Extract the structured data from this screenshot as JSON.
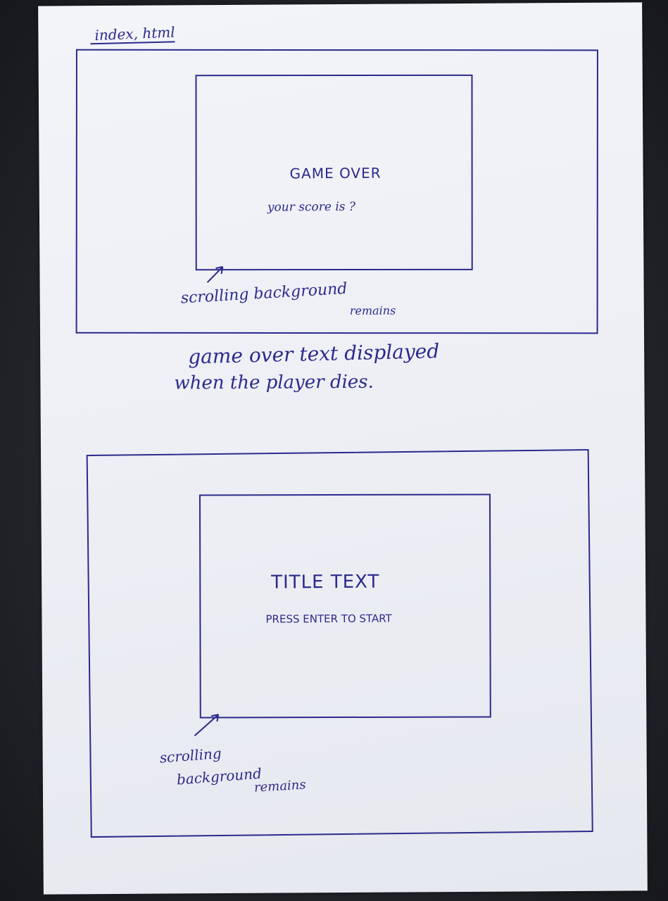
{
  "page_label": "index, html",
  "sketch_game_over": {
    "heading": "GAME OVER",
    "score_line": "your score is ?",
    "annotation_line1": "scrolling background",
    "annotation_line2": "remains"
  },
  "caption": {
    "line1": "game over text displayed",
    "line2": "when the player dies."
  },
  "sketch_title": {
    "heading": "TITLE TEXT",
    "prompt": "PRESS ENTER TO START",
    "annotation_line1": "scrolling",
    "annotation_line2": "background",
    "annotation_line3": "remains"
  },
  "colors": {
    "ink": "#2c2a8c",
    "paper": "#eceef4"
  }
}
